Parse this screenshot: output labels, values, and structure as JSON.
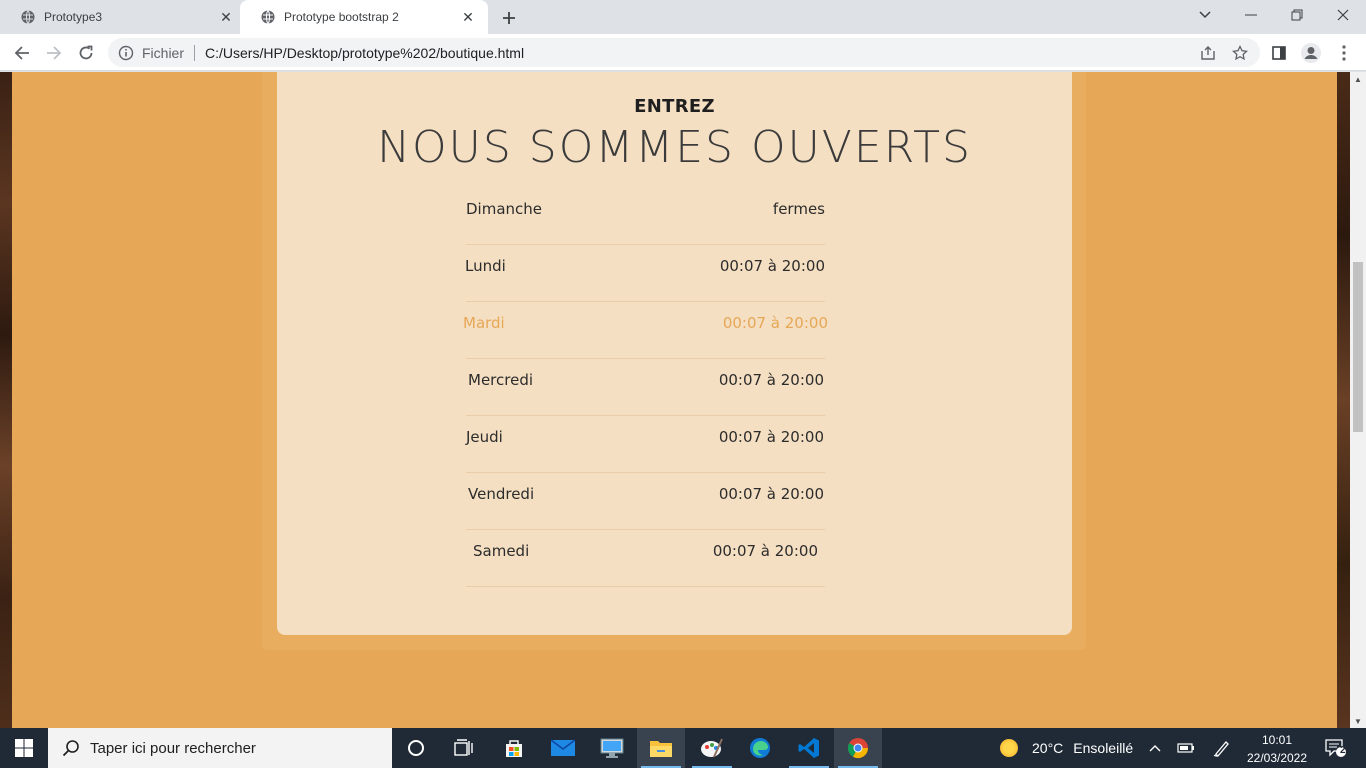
{
  "browser": {
    "tabs": [
      {
        "title": "Prototype3",
        "active": false
      },
      {
        "title": "Prototype bootstrap 2",
        "active": true
      }
    ],
    "omnibox": {
      "scheme_label": "Fichier",
      "url": "C:/Users/HP/Desktop/prototype%202/boutique.html"
    }
  },
  "page": {
    "subtitle": "ENTREZ",
    "headline": "NOUS SOMMES OUVERTS",
    "hours": [
      {
        "day": "Dimanche",
        "time": "fermes"
      },
      {
        "day": "Lundi",
        "time": "00:07 à 20:00"
      },
      {
        "day": "Mardi",
        "time": "00:07 à 20:00",
        "highlighted": true
      },
      {
        "day": "Mercredi",
        "time": "00:07 à 20:00"
      },
      {
        "day": "Jeudi",
        "time": "00:07 à 20:00"
      },
      {
        "day": "Vendredi",
        "time": "00:07 à 20:00"
      },
      {
        "day": "Samedi",
        "time": "00:07 à 20:00"
      }
    ],
    "colors": {
      "background": "#e6a756",
      "card": "#f5dfc2",
      "highlight": "#e6a756"
    }
  },
  "taskbar": {
    "search_placeholder": "Taper ici pour rechercher",
    "apps": [
      "cortana-icon",
      "task-view-icon",
      "store-icon",
      "mail-icon",
      "remote-desktop-icon",
      "file-explorer-icon",
      "paint-icon",
      "edge-icon",
      "vscode-icon",
      "chrome-icon"
    ],
    "weather": {
      "temperature": "20°C",
      "condition": "Ensoleillé"
    },
    "clock": {
      "time": "10:01",
      "date": "22/03/2022"
    },
    "notifications_count": "2"
  }
}
